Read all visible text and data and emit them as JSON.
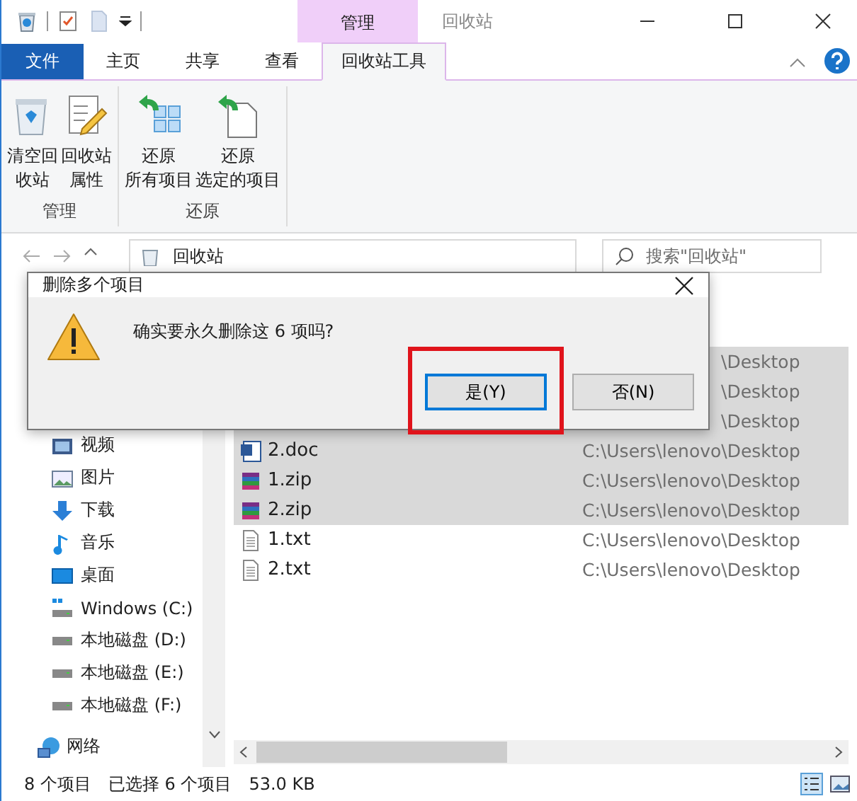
{
  "window": {
    "title": "回收站",
    "context_tab": "管理"
  },
  "ribbon": {
    "tabs": [
      {
        "label": "文件",
        "kind": "file",
        "selected": false
      },
      {
        "label": "主页",
        "kind": "tab",
        "selected": false
      },
      {
        "label": "共享",
        "kind": "tab",
        "selected": false
      },
      {
        "label": "查看",
        "kind": "tab",
        "selected": false
      },
      {
        "label": "回收站工具",
        "kind": "context",
        "selected": true
      }
    ],
    "groups": [
      {
        "label": "管理",
        "buttons": [
          {
            "lines": [
              "清空回",
              "收站"
            ],
            "kind": "empty-bin"
          },
          {
            "lines": [
              "回收站",
              "属性"
            ],
            "kind": "properties"
          }
        ]
      },
      {
        "label": "还原",
        "buttons": [
          {
            "lines": [
              "还原",
              "所有项目"
            ],
            "kind": "restore-all"
          },
          {
            "lines": [
              "还原",
              "选定的项目"
            ],
            "kind": "restore-selected"
          }
        ]
      }
    ]
  },
  "address": {
    "value": "回收站",
    "search_placeholder": "搜索\"回收站\""
  },
  "navigation": [
    {
      "label": "视频",
      "kind": "video"
    },
    {
      "label": "图片",
      "kind": "pictures"
    },
    {
      "label": "下载",
      "kind": "downloads"
    },
    {
      "label": "音乐",
      "kind": "music"
    },
    {
      "label": "桌面",
      "kind": "desktop"
    },
    {
      "label": "Windows (C:)",
      "kind": "system-drive"
    },
    {
      "label": "本地磁盘 (D:)",
      "kind": "drive"
    },
    {
      "label": "本地磁盘 (E:)",
      "kind": "drive"
    },
    {
      "label": "本地磁盘 (F:)",
      "kind": "drive"
    },
    {
      "label": "网络",
      "kind": "network"
    }
  ],
  "files": [
    {
      "kind": "covered",
      "path": "\\Desktop",
      "selected": true
    },
    {
      "kind": "covered",
      "path": "\\Desktop",
      "selected": true
    },
    {
      "kind": "covered",
      "path": "\\Desktop",
      "selected": true
    },
    {
      "kind": "doc",
      "name": "2.doc",
      "path": "C:\\Users\\lenovo\\Desktop",
      "selected": true
    },
    {
      "kind": "zip",
      "name": "1.zip",
      "path": "C:\\Users\\lenovo\\Desktop",
      "selected": true
    },
    {
      "kind": "zip",
      "name": "2.zip",
      "path": "C:\\Users\\lenovo\\Desktop",
      "selected": true
    },
    {
      "kind": "txt",
      "name": "1.txt",
      "path": "C:\\Users\\lenovo\\Desktop",
      "selected": false
    },
    {
      "kind": "txt",
      "name": "2.txt",
      "path": "C:\\Users\\lenovo\\Desktop",
      "selected": false
    }
  ],
  "status_bar": {
    "count": "8 个项目",
    "selection": "已选择 6 个项目",
    "size": "53.0 KB"
  },
  "dialog": {
    "title": "删除多个项目",
    "message": "确实要永久删除这 6 项吗?",
    "buttons": [
      {
        "label": "是(Y)",
        "selected": true,
        "highlighted": true
      },
      {
        "label": "否(N)",
        "selected": false,
        "highlighted": false
      }
    ]
  }
}
